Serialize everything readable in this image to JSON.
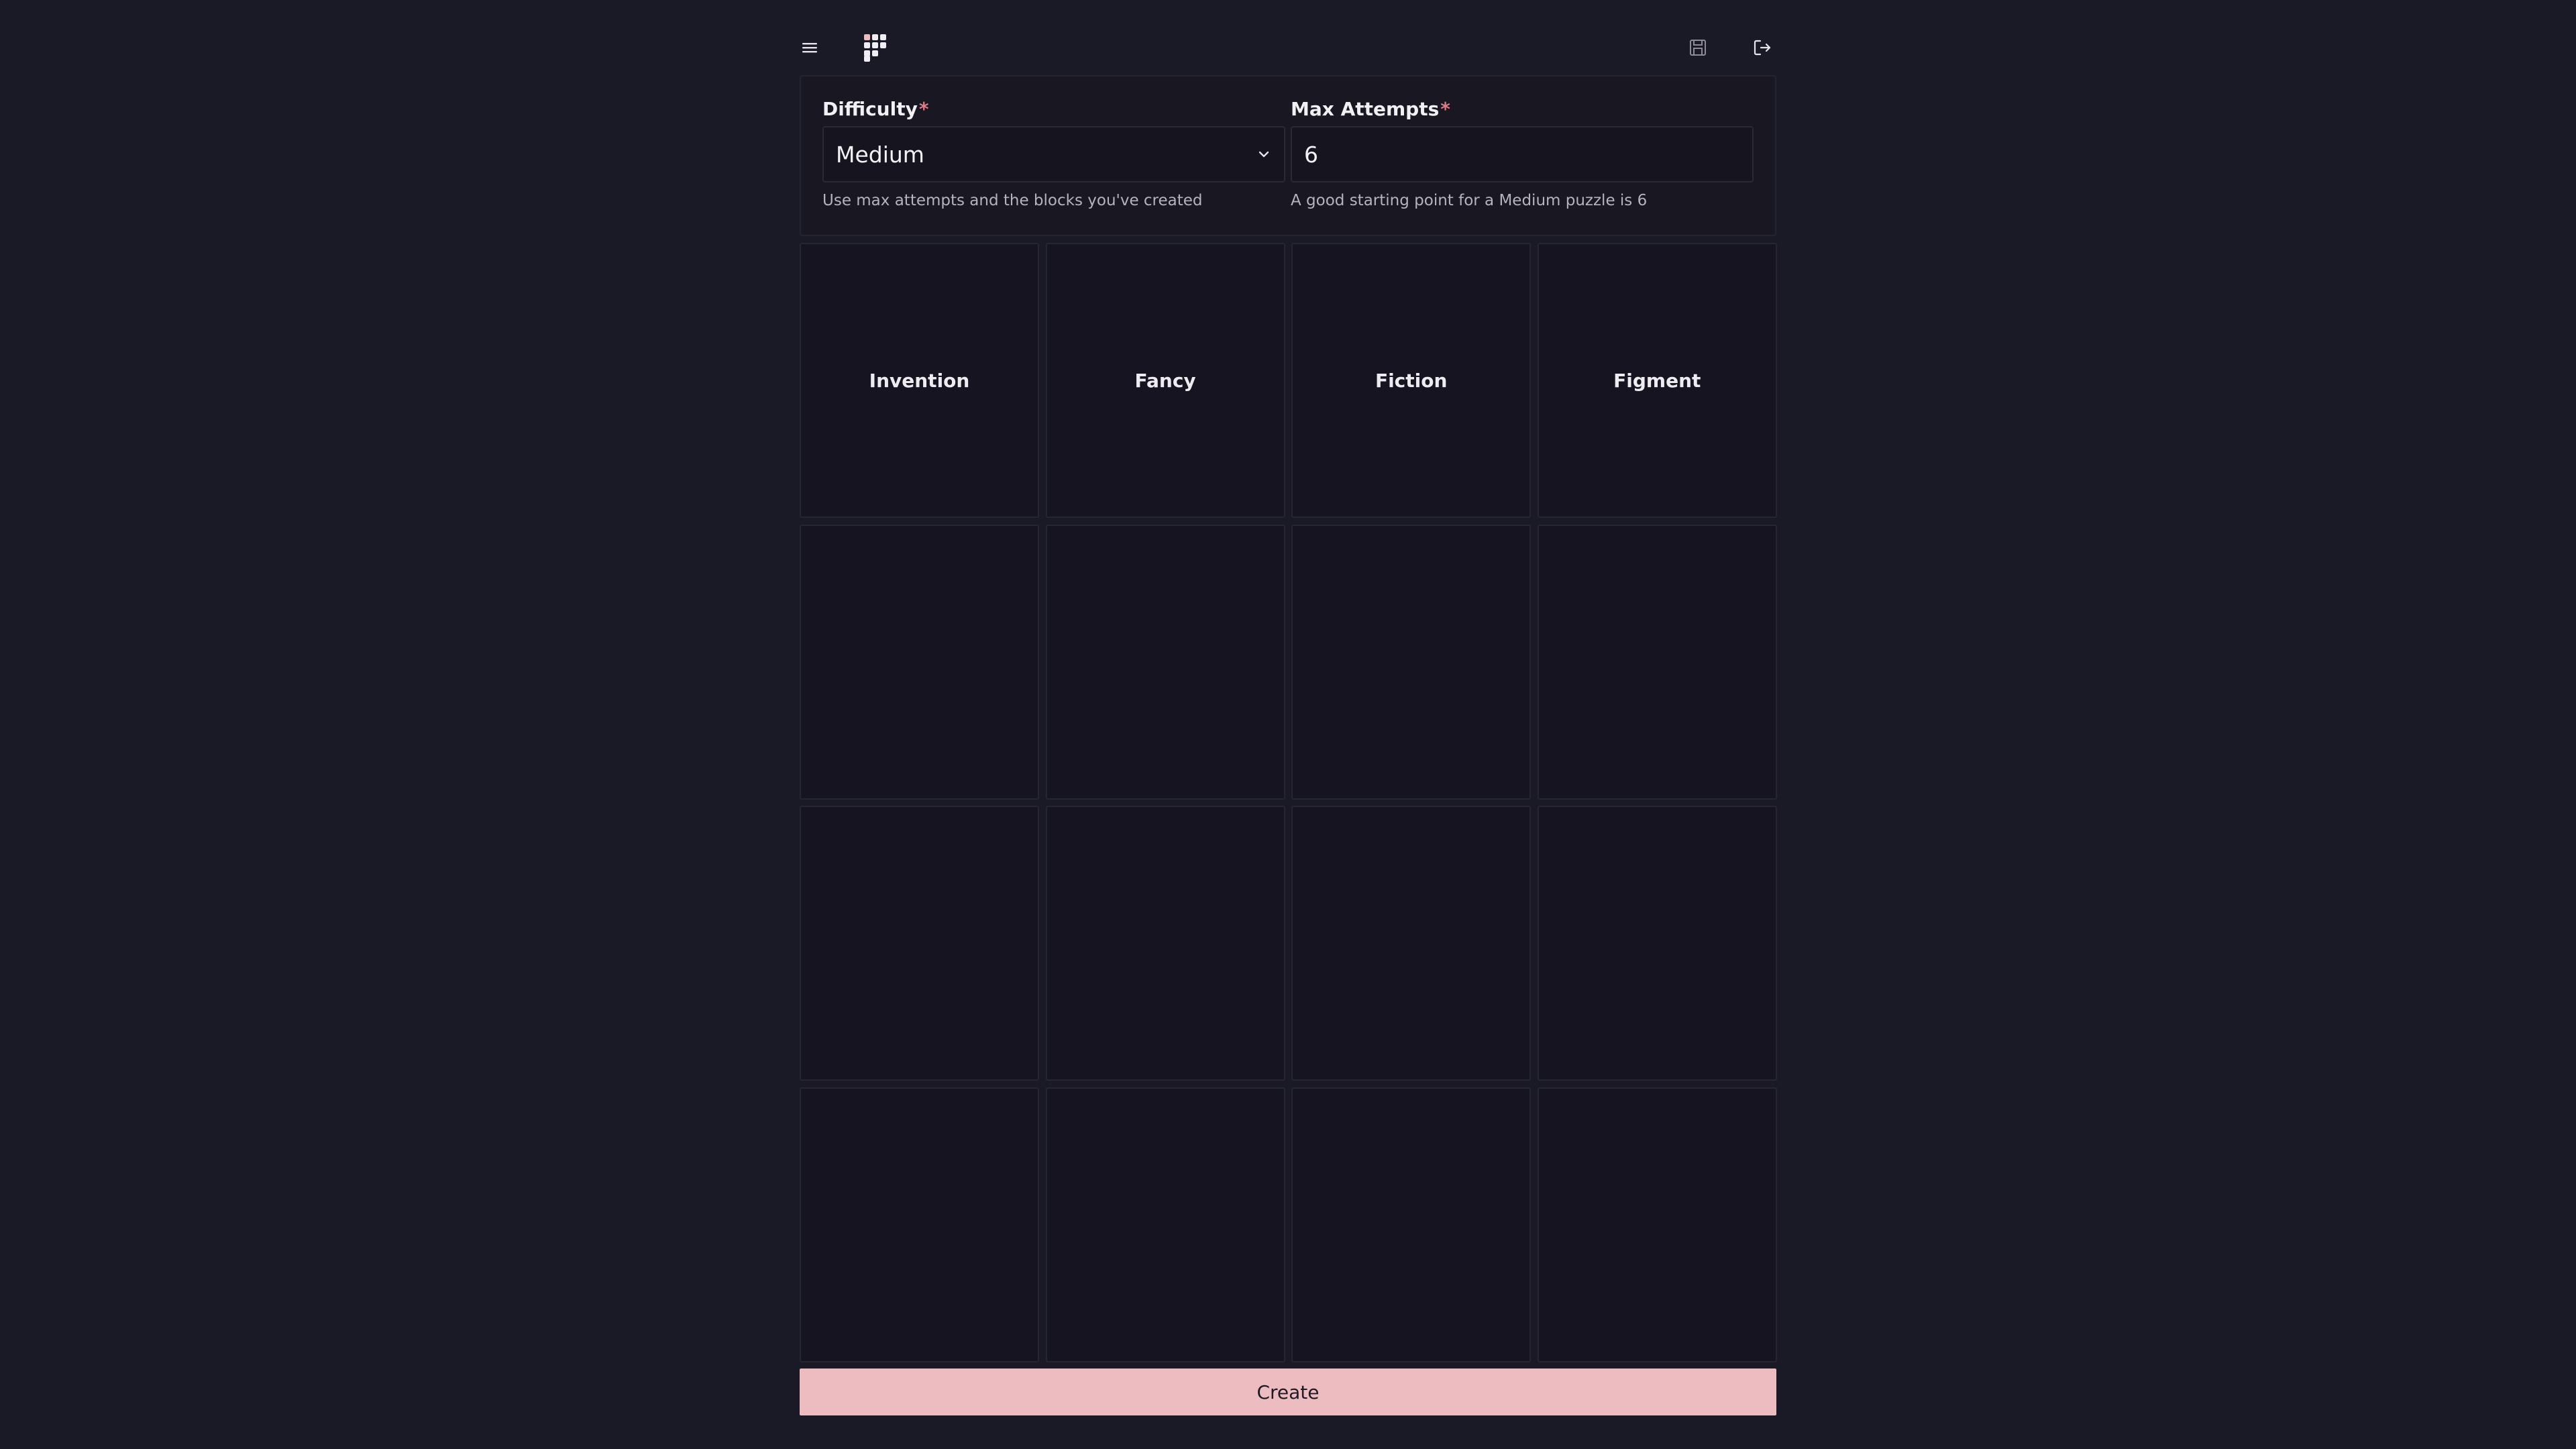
{
  "header": {
    "menu_icon": "hamburger-menu-icon",
    "logo_icon": "grid-logo-icon",
    "save_icon": "save-icon",
    "logout_icon": "logout-icon"
  },
  "settings": {
    "difficulty": {
      "label": "Difficulty",
      "required_mark": "*",
      "value": "Medium",
      "help": "Use max attempts and the blocks you've created"
    },
    "max_attempts": {
      "label": "Max Attempts",
      "required_mark": "*",
      "value": "6",
      "help": "A good starting point for a Medium puzzle is 6"
    }
  },
  "grid": {
    "cells": [
      "Invention",
      "Fancy",
      "Fiction",
      "Figment",
      "",
      "",
      "",
      "",
      "",
      "",
      "",
      "",
      "",
      "",
      "",
      ""
    ]
  },
  "actions": {
    "create_label": "Create"
  },
  "colors": {
    "background": "#1a1a26",
    "accent": "#ecbcc0",
    "required": "#e07a86"
  }
}
